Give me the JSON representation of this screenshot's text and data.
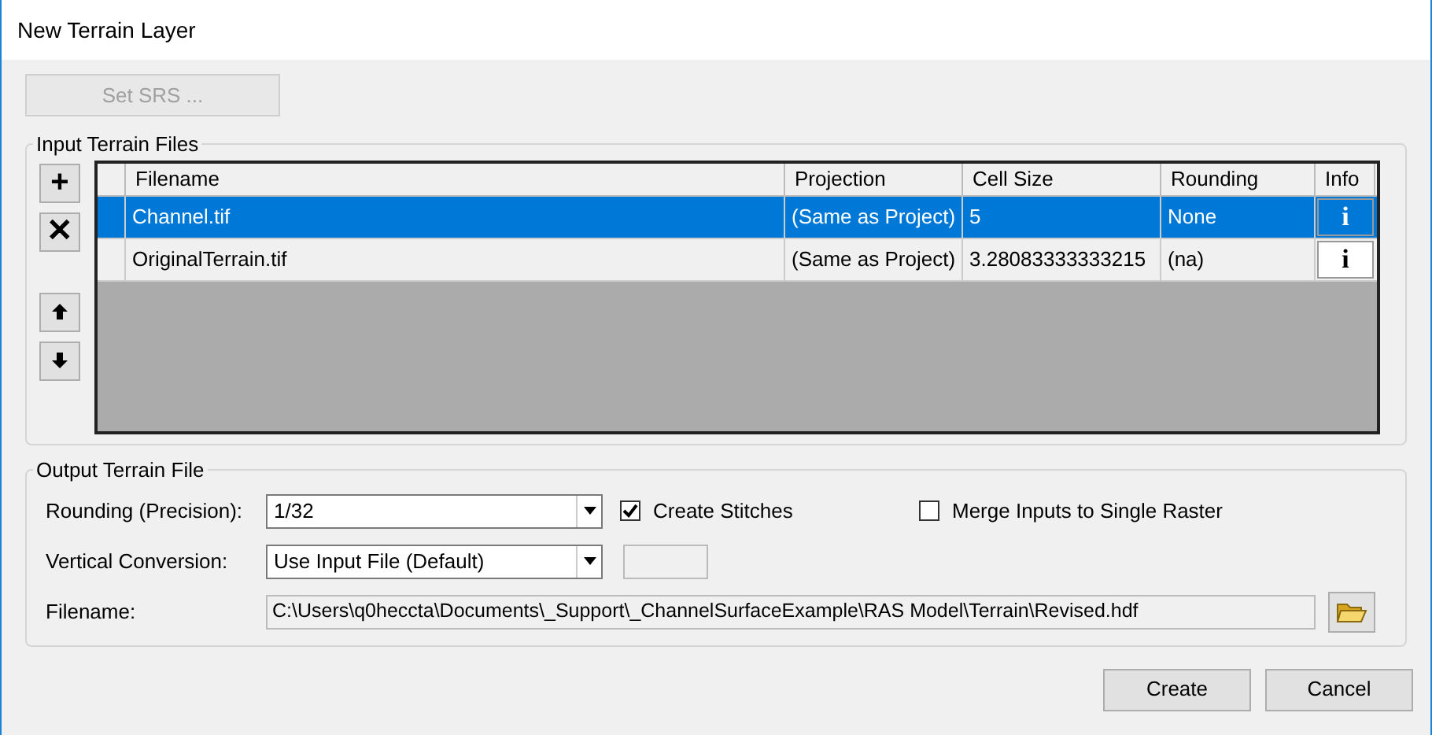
{
  "window": {
    "title": "New Terrain Layer"
  },
  "set_srs_button": {
    "label": "Set SRS ...",
    "disabled": true
  },
  "input_group": {
    "title": "Input Terrain Files",
    "side_buttons": [
      {
        "kind": "add",
        "label": "+"
      },
      {
        "kind": "remove",
        "label": "✕"
      },
      {
        "kind": "up"
      },
      {
        "kind": "down"
      }
    ],
    "columns": [
      "Filename",
      "Projection",
      "Cell Size",
      "Rounding",
      "Info"
    ],
    "rows": [
      {
        "selected": true,
        "cells": [
          "Channel.tif",
          "(Same as Project)",
          "5",
          "None"
        ],
        "info": "i"
      },
      {
        "selected": false,
        "cells": [
          "OriginalTerrain.tif",
          "(Same as Project)",
          "3.28083333333215",
          "(na)"
        ],
        "info": "i"
      }
    ]
  },
  "output_group": {
    "title": "Output Terrain File",
    "rounding": {
      "label": "Rounding (Precision):",
      "value": "1/32"
    },
    "create_stitches": {
      "label": "Create Stitches",
      "checked": true
    },
    "merge_inputs": {
      "label": "Merge Inputs to Single Raster",
      "checked": false
    },
    "vertical_conversion": {
      "label": "Vertical Conversion:",
      "value": "Use Input File (Default)"
    },
    "filename": {
      "label": "Filename:",
      "value": "C:\\Users\\q0heccta\\Documents\\_Support\\_ChannelSurfaceExample\\RAS Model\\Terrain\\Revised.hdf"
    }
  },
  "buttons": [
    "Create",
    "Cancel"
  ]
}
